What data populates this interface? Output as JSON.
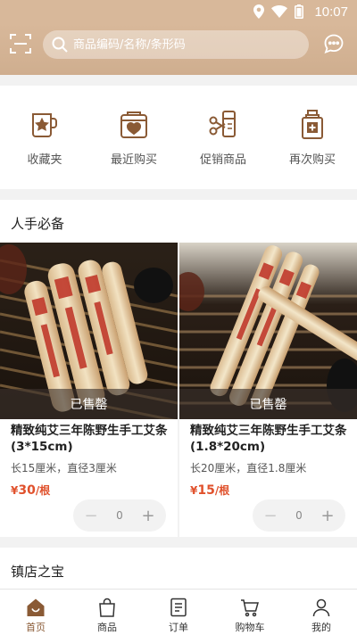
{
  "status_bar": {
    "time": "10:07"
  },
  "header": {
    "search_placeholder": "商品编码/名称/条形码"
  },
  "quick_links": [
    {
      "label": "收藏夹",
      "icon": "mug-star-icon"
    },
    {
      "label": "最近购买",
      "icon": "bag-heart-icon"
    },
    {
      "label": "促销商品",
      "icon": "scissors-coupon-icon"
    },
    {
      "label": "再次购买",
      "icon": "bottle-plus-icon"
    }
  ],
  "sections": {
    "must_have": "人手必备",
    "treasure": "镇店之宝"
  },
  "products": [
    {
      "sold_label": "已售罄",
      "name": "精致纯艾三年陈野生手工艾条(3*15cm)",
      "spec": "长15厘米，直径3厘米",
      "currency": "¥",
      "price": "30",
      "unit": "/根",
      "quantity": "0",
      "minus": "−",
      "plus": "+"
    },
    {
      "sold_label": "已售罄",
      "name": "精致纯艾三年陈野生手工艾条(1.8*20cm)",
      "spec": "长20厘米，直径1.8厘米",
      "currency": "¥",
      "price": "15",
      "unit": "/根",
      "quantity": "0",
      "minus": "−",
      "plus": "+"
    }
  ],
  "tabbar": [
    {
      "label": "首页",
      "icon": "home-icon",
      "active": true
    },
    {
      "label": "商品",
      "icon": "shopping-bag-icon",
      "active": false
    },
    {
      "label": "订单",
      "icon": "order-list-icon",
      "active": false
    },
    {
      "label": "购物车",
      "icon": "cart-icon",
      "active": false
    },
    {
      "label": "我的",
      "icon": "user-icon",
      "active": false
    }
  ],
  "colors": {
    "brand": "#d8b89a",
    "accent": "#8a5a35",
    "price": "#e0512c"
  }
}
